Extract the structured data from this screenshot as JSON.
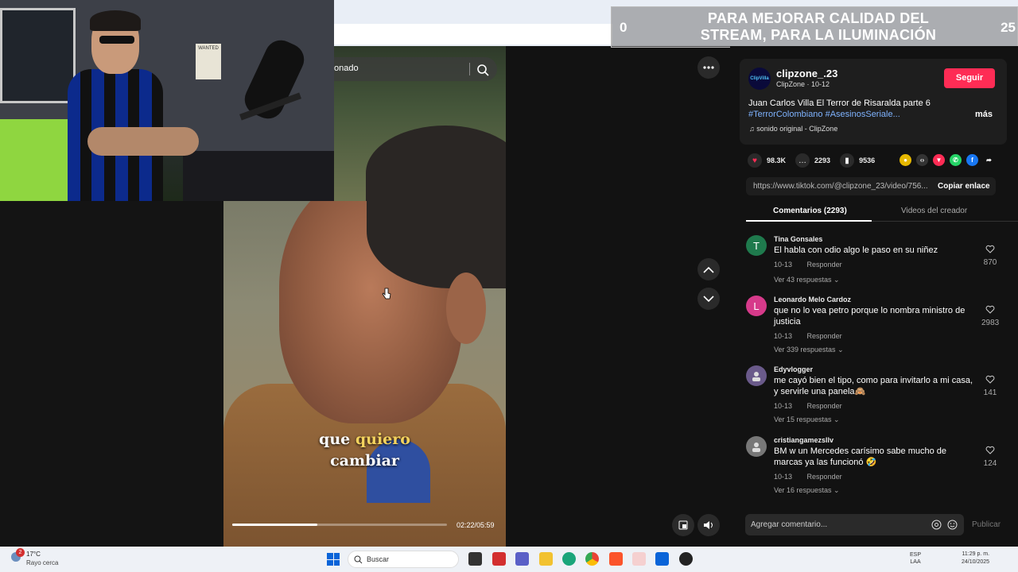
{
  "overlay": {
    "left_number": "0",
    "right_number": "25",
    "message": "PARA MEJORAR CALIDAD DEL STREAM, PARA LA ILUMINACIÓN"
  },
  "webcam": {
    "poster_text": "WANTED"
  },
  "video": {
    "search_fragment": "onado",
    "caption_plain": "que",
    "caption_highlight": "quiero",
    "caption_line2": "cambiar",
    "time": "02:22/05:59",
    "progress_fraction": 0.397,
    "accent_highlight_color": "#f4d35e"
  },
  "author": {
    "avatar_text": "ClipVilla",
    "username": "clipzone_.23",
    "subtitle": "ClipZone · 10-12",
    "follow_label": "Seguir",
    "follow_color": "#fe2c55"
  },
  "post": {
    "description": "Juan Carlos Villa El Terror de Risaralda parte 6",
    "hashtags": "#TerrorColombiano #AsesinosSeriale...",
    "more_label": "más",
    "sound": "sonido original - ClipZone"
  },
  "stats": {
    "likes": "98.3K",
    "comments": "2293",
    "saves": "9536"
  },
  "link": {
    "url": "https://www.tiktok.com/@clipzone_23/video/756...",
    "copy_label": "Copiar enlace"
  },
  "tabs": {
    "comments": "Comentarios (2293)",
    "creator_videos": "Videos del creador"
  },
  "comments": [
    {
      "avatar": "T",
      "avatar_color": "#1f7a4d",
      "name": "Tina Gonsales",
      "text": "El habla con odio algo le paso en su niñez",
      "date": "10-13",
      "reply_label": "Responder",
      "replies": "Ver 43 respuestas",
      "likes": "870"
    },
    {
      "avatar": "L",
      "avatar_color": "#d63a8a",
      "name": "Leonardo Melo Cardoz",
      "text": "que no lo vea petro porque lo nombra ministro de justicia",
      "date": "10-13",
      "reply_label": "Responder",
      "replies": "Ver 339 respuestas",
      "likes": "2983"
    },
    {
      "avatar": "",
      "avatar_color": "#6a5a8a",
      "name": "Edyvlogger",
      "text": "me cayó bien el tipo, como para invitarlo a mi casa, y servirle una panela🙈",
      "date": "10-13",
      "reply_label": "Responder",
      "replies": "Ver 15 respuestas",
      "likes": "141"
    },
    {
      "avatar": "",
      "avatar_color": "#777777",
      "name": "cristiangamezsllv",
      "text": "BM w un Mercedes carísimo sabe mucho de marcas ya las funcionó 🤣",
      "date": "10-13",
      "reply_label": "Responder",
      "replies": "Ver 16 respuestas",
      "likes": "124"
    }
  ],
  "comment_input": {
    "placeholder": "Agregar comentario...",
    "publish_label": "Publicar"
  },
  "taskbar": {
    "weather_temp": "17°C",
    "weather_desc": "Rayo cerca",
    "notification_count": "2",
    "search_label": "Buscar",
    "lang_line1": "ESP",
    "lang_line2": "LAA",
    "time": "11:29 p. m.",
    "date": "24/10/2025"
  }
}
